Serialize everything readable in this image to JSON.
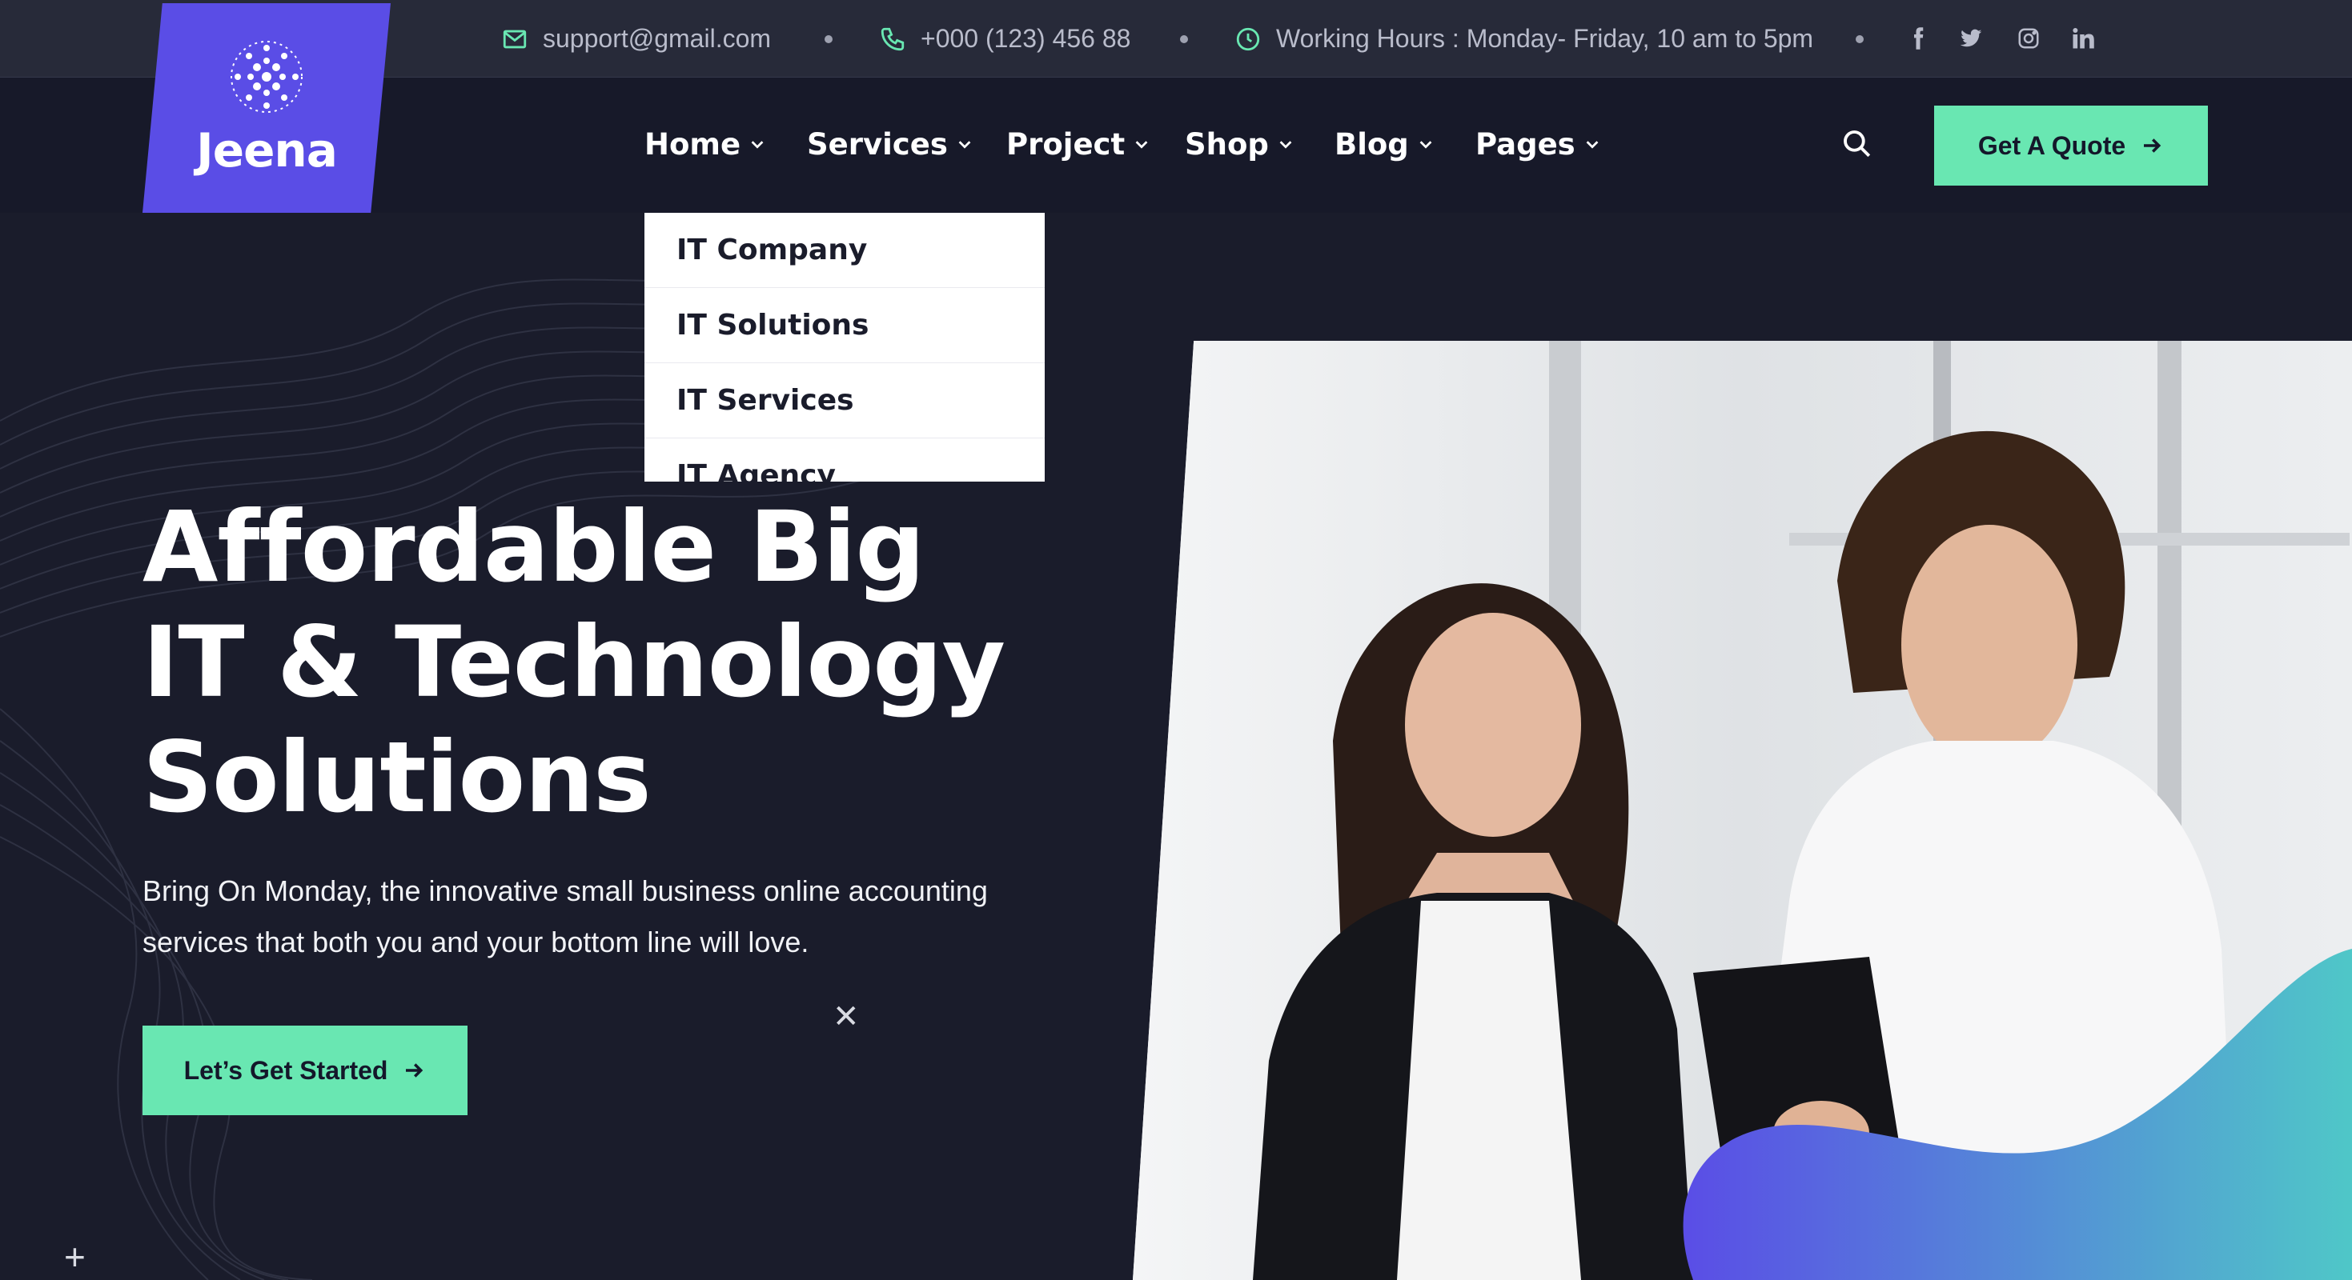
{
  "topbar": {
    "email": "support@gmail.com",
    "phone": "+000 (123) 456 88",
    "hours": "Working Hours : Monday- Friday, 10 am to 5pm",
    "social": [
      "facebook-icon",
      "twitter-icon",
      "instagram-icon",
      "linkedin-icon"
    ]
  },
  "brand": {
    "name": "Jeena",
    "color": "#5a4de6"
  },
  "nav": {
    "items": [
      {
        "label": "Home"
      },
      {
        "label": "Services"
      },
      {
        "label": "Project"
      },
      {
        "label": "Shop"
      },
      {
        "label": "Blog"
      },
      {
        "label": "Pages"
      }
    ],
    "cta": "Get A Quote"
  },
  "dropdown": {
    "items": [
      "IT Company",
      "IT Solutions",
      "IT Services",
      "IT Agency"
    ]
  },
  "hero": {
    "title_line1": "Affordable Big",
    "title_line2": "IT & Technology",
    "title_line3": "Solutions",
    "subtitle_line1": "Bring On Monday, the innovative small business online accounting",
    "subtitle_line2": "services that both you and your bottom line will love.",
    "cta": "Let’s Get Started"
  },
  "colors": {
    "accent": "#69e7b2",
    "brand": "#5a4de6",
    "background": "#1a1c2b",
    "topbar": "#272a39"
  }
}
